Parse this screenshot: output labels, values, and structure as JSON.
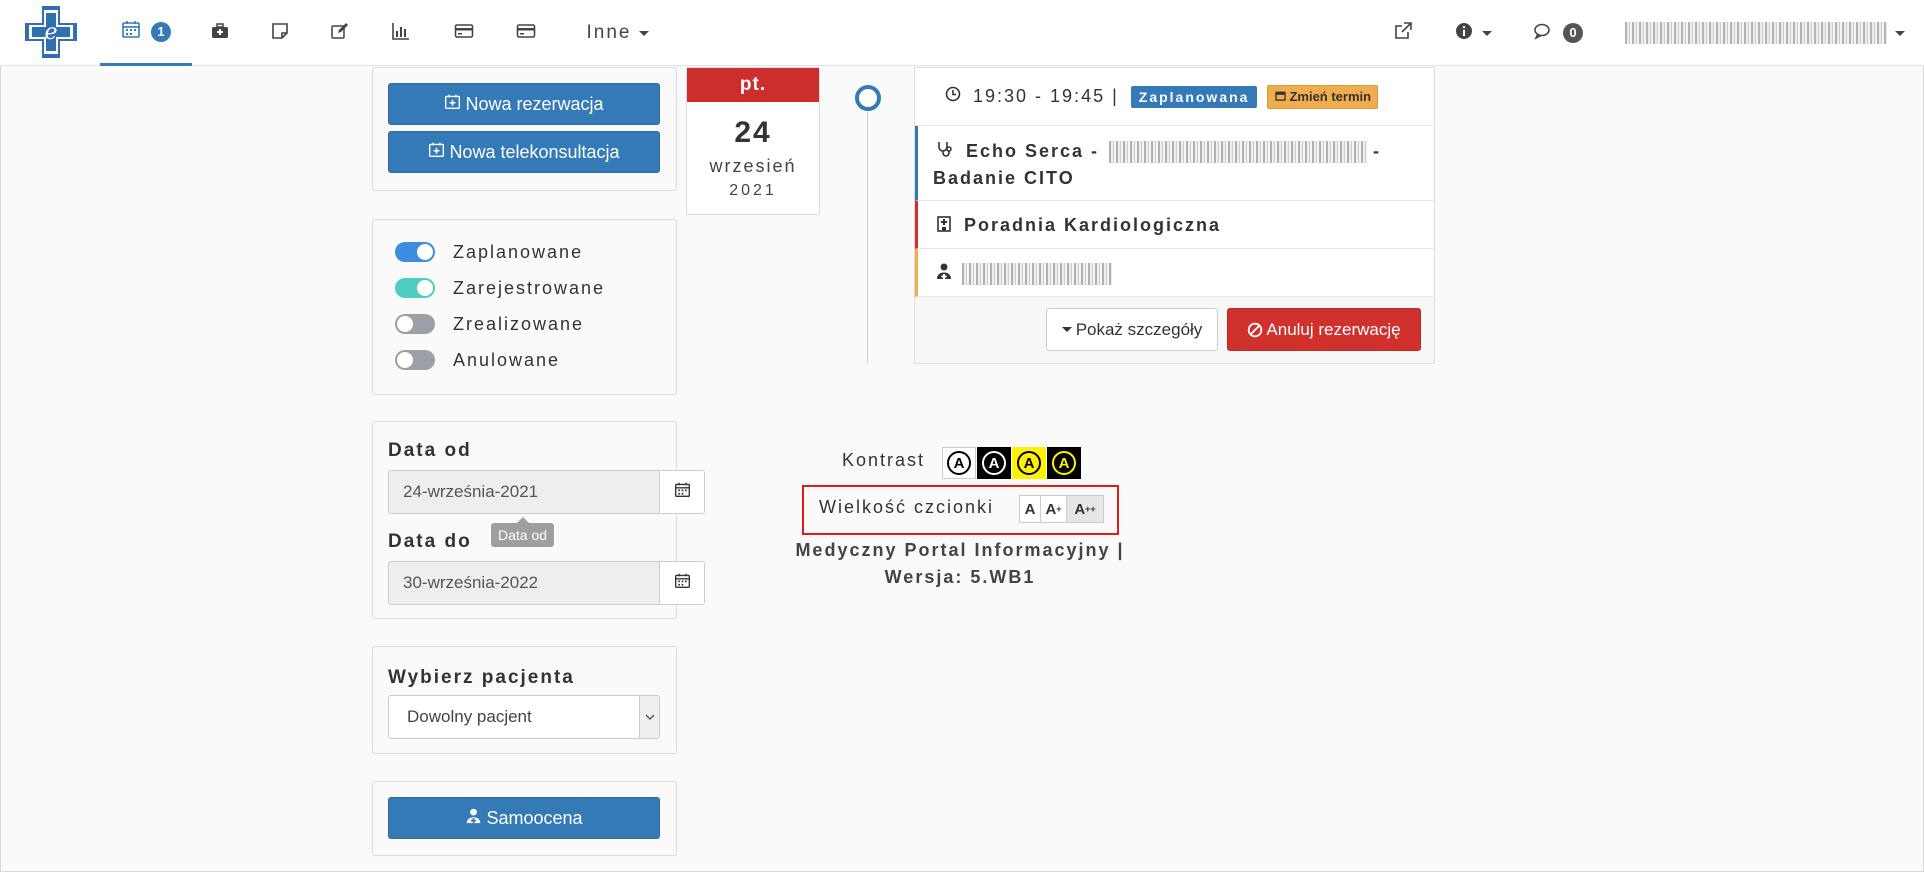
{
  "nav": {
    "calendar_badge": "1",
    "inne_label": "Inne",
    "messages_badge": "0"
  },
  "actions": {
    "new_reservation": "Nowa rezerwacja",
    "new_teleconsultation": "Nowa telekonsultacja",
    "self_assessment": "Samoocena"
  },
  "filters": [
    {
      "label": "Zaplanowane",
      "on": true,
      "color": "#3c8dde"
    },
    {
      "label": "Zarejestrowane",
      "on": true,
      "color": "#4ecdc4"
    },
    {
      "label": "Zrealizowane",
      "on": false,
      "color": "#9aa0a6"
    },
    {
      "label": "Anulowane",
      "on": false,
      "color": "#9aa0a6"
    }
  ],
  "dates": {
    "from_label": "Data od",
    "from_value": "24-września-2021",
    "tooltip": "Data od",
    "to_label": "Data do",
    "to_value": "30-września-2022"
  },
  "patient": {
    "label": "Wybierz pacjenta",
    "value": "Dowolny pacjent"
  },
  "date_card": {
    "dow": "pt.",
    "day": "24",
    "month": "wrzesień",
    "year": "2021"
  },
  "appointment": {
    "time": "19:30 - 19:45 |",
    "status": "Zaplanowana",
    "change_term": "Zmień termin",
    "service_prefix": "Echo Serca -",
    "service_suffix": "-",
    "service_line2": "Badanie CITO",
    "clinic": "Poradnia Kardiologiczna",
    "show_details": "Pokaż szczegóły",
    "cancel": "Anuluj rezerwację"
  },
  "footer": {
    "contrast_label": "Kontrast",
    "font_size_label": "Wielkość czcionki",
    "font_a": "A",
    "font_a_plus": "A",
    "font_a_plus_sup": "+",
    "font_a_plusplus": "A",
    "font_a_plusplus_sup": "++",
    "portal_line1": "Medyczny Portal Informacyjny |",
    "portal_line2": "Wersja: 5.WB1"
  },
  "colors": {
    "primary": "#337ab7",
    "danger": "#d0312d",
    "warning": "#f0ad4e",
    "highlight_border": "#e01b1b",
    "date_header": "#cc2e2e"
  }
}
